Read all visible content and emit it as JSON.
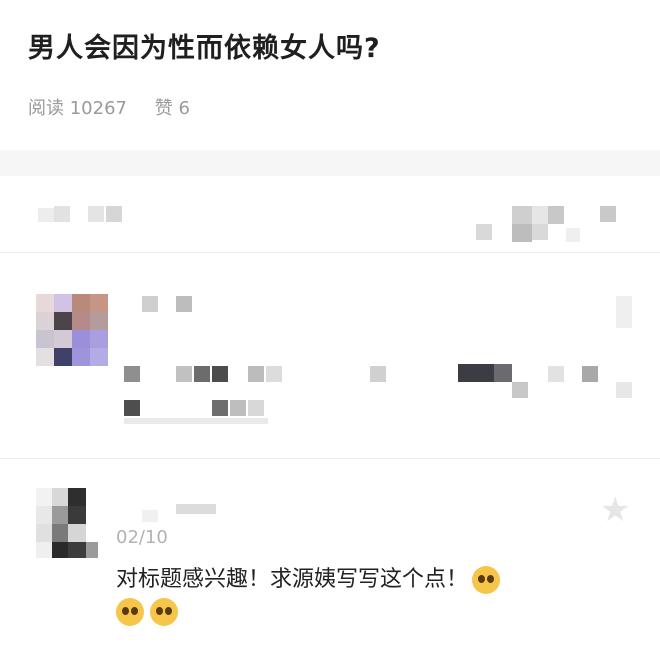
{
  "post": {
    "title": "男人会因为性而依赖女人吗?",
    "reads_label": "阅读 10267",
    "likes_label": "赞 6"
  },
  "comment2": {
    "date": "02/10",
    "text": "对标题感兴趣！求源姨写写这个点！"
  },
  "icons": {
    "star": "star-icon",
    "emoji": "pleading-face-emoji"
  },
  "colors": {
    "title": "#1f1f1f",
    "meta": "#9a9a9a",
    "date": "#b2b2b2"
  }
}
